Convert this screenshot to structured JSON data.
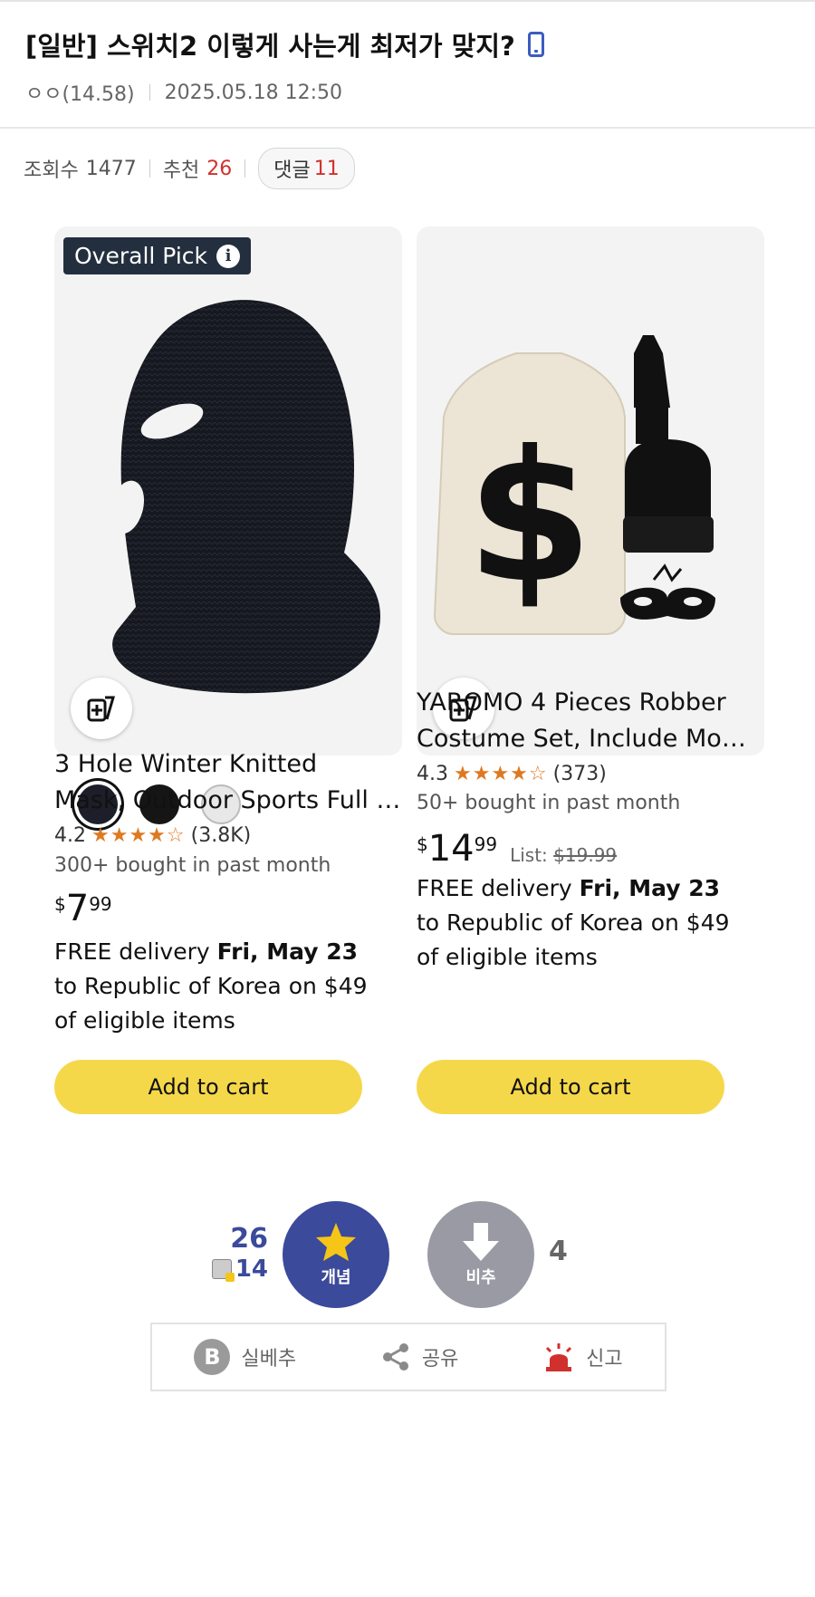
{
  "post": {
    "title": "[일반] 스위치2 이렇게 사는게 최저가 맞지?",
    "author": "ㅇㅇ(14.58)",
    "date": "2025.05.18 12:50"
  },
  "stats": {
    "views_label": "조회수",
    "views": "1477",
    "recommend_label": "추천",
    "recommend": "26",
    "comments_label": "댓글",
    "comments": "11"
  },
  "products": [
    {
      "badge": "Overall Pick",
      "badge_info": "i",
      "title_line1": "3 Hole Winter Knitted",
      "title_line2": "Mask, Outdoor Sports Full Face Mask",
      "rating": "4.2",
      "stars": "★★★★☆",
      "reviews": "(3.8K)",
      "bought": "300+ bought in past month",
      "price_currency": "$",
      "price_whole": "7",
      "price_fraction": "99",
      "delivery_prefix": "FREE delivery ",
      "delivery_date": "Fri, May 23",
      "delivery_rest": " to Republic of Korea on $49 of eligible items",
      "cart_label": "Add to cart",
      "swatch_colors": [
        "#1c1f2a",
        "#151515",
        "#e8e8e8"
      ]
    },
    {
      "title_line1": "YAROMO 4 Pieces Robber",
      "title_line2": "Costume Set, Include Money Bag",
      "rating": "4.3",
      "stars": "★★★★☆",
      "reviews": "(373)",
      "bought": "50+ bought in past month",
      "price_currency": "$",
      "price_whole": "14",
      "price_fraction": "99",
      "list_label": "List:",
      "list_price": "$19.99",
      "delivery_prefix": "FREE delivery ",
      "delivery_date": "Fri, May 23",
      "delivery_rest": " to Republic of Korea on $49 of eligible items",
      "cart_label": "Add to cart"
    }
  ],
  "vote": {
    "up_count": "26",
    "fixed_count": "14",
    "up_label": "개념",
    "down_label": "비추",
    "down_count": "4"
  },
  "actions": {
    "best_icon": "B",
    "best_label": "실베추",
    "share_label": "공유",
    "report_label": "신고"
  },
  "colors": {
    "accent_blue": "#3b4a9a",
    "red": "#d0312d",
    "cart_yellow": "#f5d84a",
    "star_orange": "#de7921"
  }
}
